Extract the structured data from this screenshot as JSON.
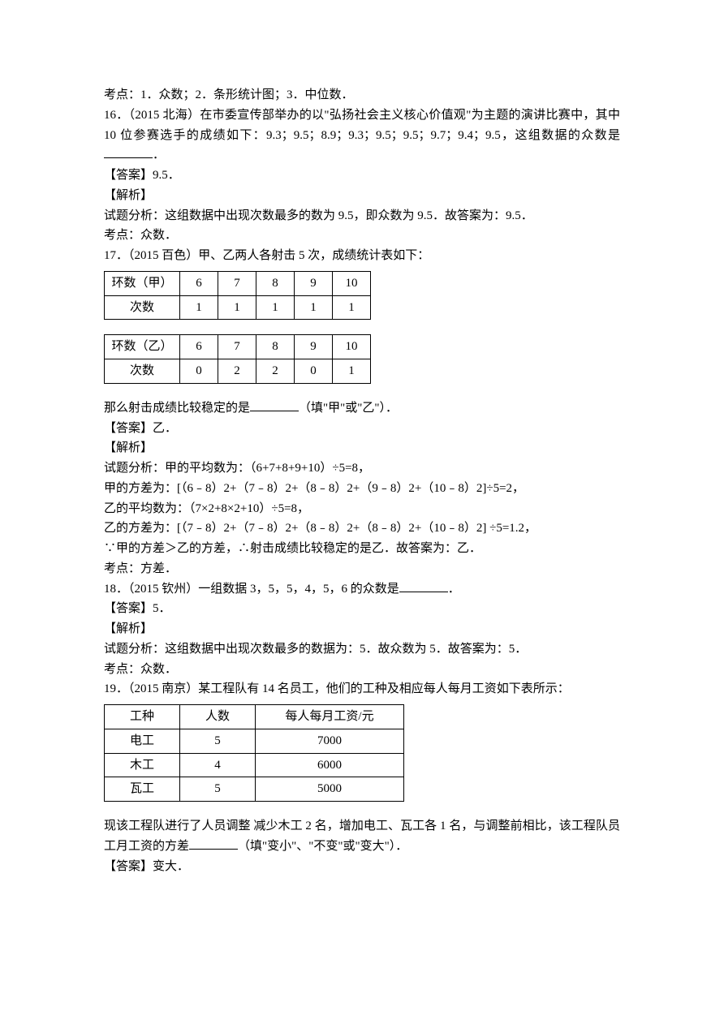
{
  "line_top": "考点：1．众数；2．条形统计图；3．中位数．",
  "q16": {
    "text": "16．（2015 北海）在市委宣传部举办的以\"弘扬社会主义核心价值观\"为主题的演讲比赛中，其中 10 位参赛选手的成绩如下：9.3；9.5；8.9；9.3；9.5；9.5；9.7；9.4；9.5，这组数据的众数是",
    "period": "．",
    "ans_label": "【答案】9.5．",
    "jiexi_label": "【解析】",
    "analysis": "试题分析：这组数据中出现次数最多的数为 9.5，即众数为 9.5．故答案为：9.5．",
    "kaodian": "考点：众数．"
  },
  "q17": {
    "text": "17．（2015 百色）甲、乙两人各射击 5 次，成绩统计表如下：",
    "tableA": {
      "row1": [
        "环数（甲）",
        "6",
        "7",
        "8",
        "9",
        "10"
      ],
      "row2": [
        "次数",
        "1",
        "1",
        "1",
        "1",
        "1"
      ]
    },
    "tableB": {
      "row1": [
        "环数（乙）",
        "6",
        "7",
        "8",
        "9",
        "10"
      ],
      "row2": [
        "次数",
        "0",
        "2",
        "2",
        "0",
        "1"
      ]
    },
    "post_text_a": "那么射击成绩比较稳定的是",
    "post_text_b": "（填\"甲\"或\"乙\"）．",
    "ans_label": "【答案】乙．",
    "jiexi_label": "【解析】",
    "analysis1": "试题分析：甲的平均数为：（6+7+8+9+10）÷5=8，",
    "analysis2": "甲的方差为：[（6﹣8）2+（7﹣8）2+（8﹣8）2+（9﹣8）2+（10﹣8）2]÷5=2，",
    "analysis3": "乙的平均数为：（7×2+8×2+10）÷5=8，",
    "analysis4": "乙的方差为：[（7﹣8）2+（7﹣8）2+（8﹣8）2+（8﹣8）2+（10﹣8）2] ÷5=1.2，",
    "analysis5": "∵甲的方差＞乙的方差，∴射击成绩比较稳定的是乙．故答案为：乙．",
    "kaodian": "考点：方差．"
  },
  "q18": {
    "text_a": "18．（2015 钦州）一组数据 3，5，5，4，5，6 的众数是",
    "text_b": "．",
    "ans_label": "【答案】5．",
    "jiexi_label": "【解析】",
    "analysis": "试题分析：这组数据中出现次数最多的数据为：5．故众数为 5．故答案为：5．",
    "kaodian": "考点：众数．"
  },
  "q19": {
    "text": "19．（2015 南京）某工程队有 14 名员工，他们的工种及相应每人每月工资如下表所示：",
    "table": {
      "hdr": [
        "工种",
        "人数",
        "每人每月工资/元"
      ],
      "r1": [
        "电工",
        "5",
        "7000"
      ],
      "r2": [
        "木工",
        "4",
        "6000"
      ],
      "r3": [
        "瓦工",
        "5",
        "5000"
      ]
    },
    "post_a": "现该工程队进行了人员调整 减少木工 2 名，增加电工、瓦工各 1 名，与调整前相比，该工程队员工月工资的方差",
    "post_b": "（填\"变小\"、\"不变\"或\"变大\"）．",
    "ans_label": "【答案】变大．"
  }
}
